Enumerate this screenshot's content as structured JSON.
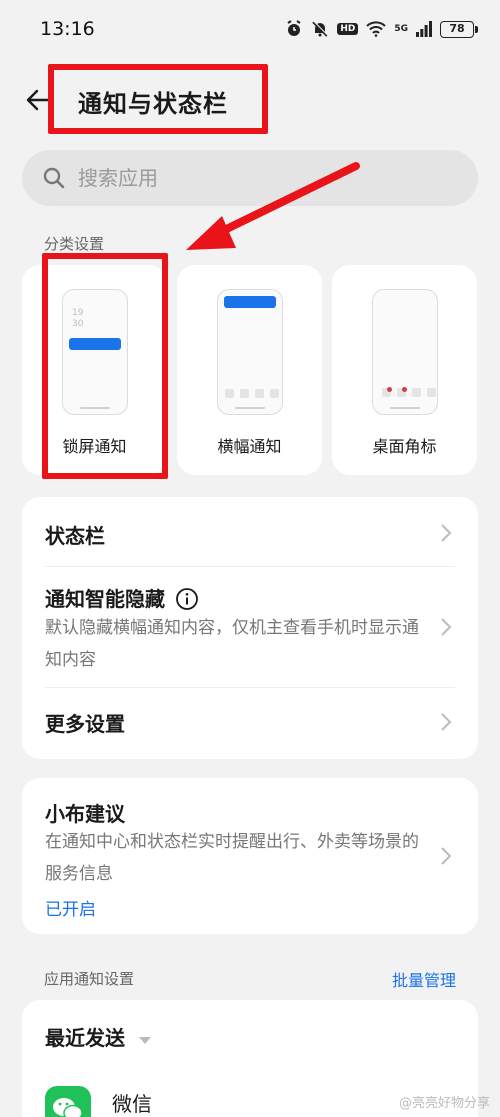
{
  "status_bar": {
    "time": "13:16",
    "hd": "HD",
    "network": "5G",
    "battery": "78"
  },
  "header": {
    "title": "通知与状态栏"
  },
  "search": {
    "placeholder": "搜索应用"
  },
  "category": {
    "section_label": "分类设置",
    "lock_time": "19\n30",
    "items": [
      {
        "label": "锁屏通知"
      },
      {
        "label": "横幅通知"
      },
      {
        "label": "桌面角标"
      }
    ]
  },
  "settings": {
    "status_bar": "状态栏",
    "smart_hide_title": "通知智能隐藏",
    "smart_hide_desc": "默认隐藏横幅通知内容，仅机主查看手机时显示通知内容",
    "more": "更多设置"
  },
  "suggestion": {
    "title": "小布建议",
    "desc": "在通知中心和状态栏实时提醒出行、外卖等场景的服务信息",
    "status": "已开启"
  },
  "app_notifications": {
    "section_label": "应用通知设置",
    "batch": "批量管理",
    "sort_label": "最近发送",
    "apps": [
      {
        "name": "微信"
      }
    ]
  },
  "watermark": "@亮亮好物分享",
  "colors": {
    "accent": "#1a73e8",
    "annotation": "#e8141a",
    "wechat": "#21c15a"
  }
}
